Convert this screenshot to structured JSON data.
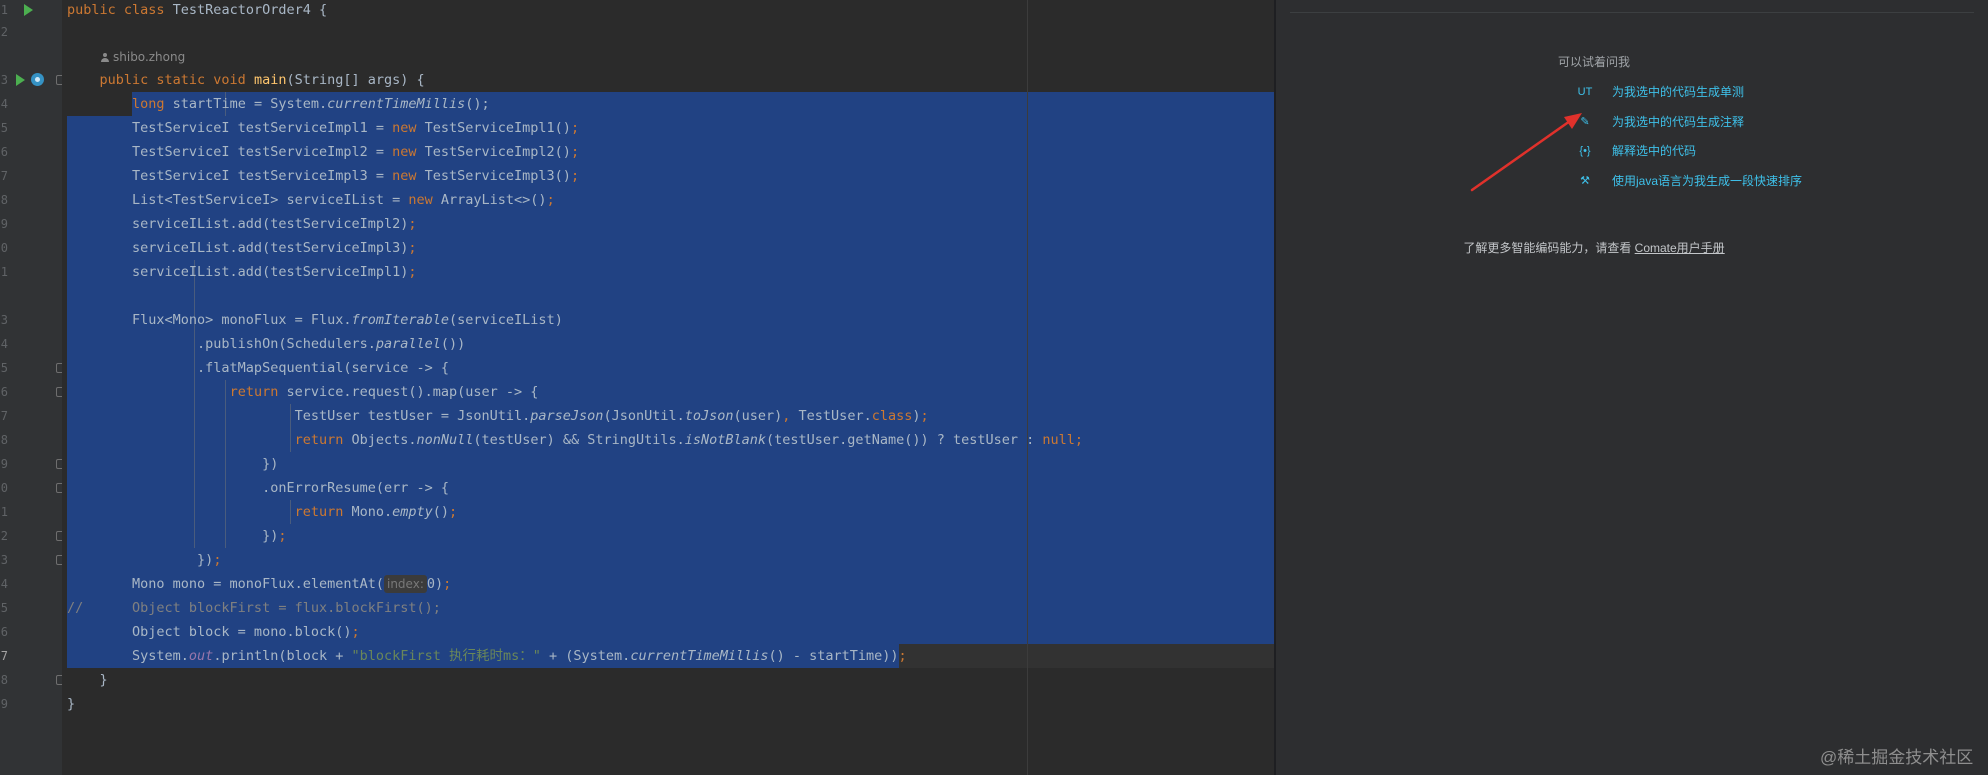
{
  "editor": {
    "author": "shibo.zhong",
    "param_hint": "index:",
    "line_numbers": [
      "1",
      "2",
      "",
      "3",
      "4",
      "5",
      "6",
      "7",
      "8",
      "9",
      "0",
      "1",
      "",
      "3",
      "4",
      "5",
      "6",
      "7",
      "8",
      "9",
      "0",
      "1",
      "2",
      "3",
      "4",
      "5",
      "6",
      "7",
      "8",
      "9",
      ""
    ],
    "code": {
      "l1a": "public class ",
      "l1b": "TestReactorOrder4 {",
      "l3a": "    public static void ",
      "l3b": "main",
      "l3c": "(String[] args) {",
      "l4a": "        long ",
      "l4b": "startTime = System.",
      "l4c": "currentTimeMillis",
      "l4d": "();",
      "l5a": "        TestServiceI testServiceImpl1 = ",
      "l5b": "new ",
      "l5c": "TestServiceImpl1()",
      "l5d": ";",
      "l6a": "        TestServiceI testServiceImpl2 = ",
      "l6b": "new ",
      "l6c": "TestServiceImpl2()",
      "l6d": ";",
      "l7a": "        TestServiceI testServiceImpl3 = ",
      "l7b": "new ",
      "l7c": "TestServiceImpl3()",
      "l7d": ";",
      "l8a": "        List<TestServiceI> serviceIList = ",
      "l8b": "new ",
      "l8c": "ArrayList<>()",
      "l8d": ";",
      "l9a": "        serviceIList.add(testServiceImpl2)",
      "l9b": ";",
      "l10a": "        serviceIList.add(testServiceImpl3)",
      "l10b": ";",
      "l11a": "        serviceIList.add(testServiceImpl1)",
      "l11b": ";",
      "l13a": "        Flux<Mono> monoFlux = Flux.",
      "l13b": "fromIterable",
      "l13c": "(serviceIList)",
      "l14a": "                .publishOn(Schedulers.",
      "l14b": "parallel",
      "l14c": "())",
      "l15a": "                .flatMapSequential(service -> {",
      "l16a": "                    ",
      "l16b": "return ",
      "l16c": "service.request().map(user -> {",
      "l17a": "                            TestUser testUser = JsonUtil.",
      "l17b": "parseJson",
      "l17c": "(JsonUtil.",
      "l17d": "toJson",
      "l17e": "(user)",
      "l17f": ", ",
      "l17g": "TestUser.",
      "l17h": "class",
      "l17i": ")",
      "l17j": ";",
      "l18a": "                            ",
      "l18b": "return ",
      "l18c": "Objects.",
      "l18d": "nonNull",
      "l18e": "(testUser) && StringUtils.",
      "l18f": "isNotBlank",
      "l18g": "(testUser.getName()) ? testUser : ",
      "l18h": "null",
      "l18i": ";",
      "l19a": "                        })",
      "l20a": "                        .onErrorResume(err -> {",
      "l21a": "                            ",
      "l21b": "return ",
      "l21c": "Mono.",
      "l21d": "empty",
      "l21e": "()",
      "l21f": ";",
      "l22a": "                        })",
      "l22b": ";",
      "l23a": "                })",
      "l23b": ";",
      "l24a": "        Mono mono = monoFlux.elementAt(",
      "l24c": "0)",
      "l24d": ";",
      "l25a": "//      Object blockFirst = flux.blockFirst();",
      "l26a": "        Object block = mono.block()",
      "l26b": ";",
      "l27a": "        System.",
      "l27b": "out",
      "l27c": ".println(block + ",
      "l27d": "\"blockFirst 执行耗时ms：\"",
      "l27e": " + (System.",
      "l27f": "currentTimeMillis",
      "l27g": "() - startTime))",
      "l27h": ";",
      "l28a": "    }",
      "l29a": "}"
    }
  },
  "assistant": {
    "title": "可以试着问我",
    "suggestions": [
      {
        "icon": "unit-test-icon",
        "glyph": "UT",
        "label": "为我选中的代码生成单测"
      },
      {
        "icon": "comment-doc-icon",
        "glyph": "✎",
        "label": "为我选中的代码生成注释"
      },
      {
        "icon": "explain-code-icon",
        "glyph": "{•}",
        "label": "解释选中的代码"
      },
      {
        "icon": "tools-icon",
        "glyph": "⚒",
        "label": "使用java语言为我生成一段快速排序"
      }
    ],
    "more_text": "了解更多智能编码能力，请查看 ",
    "manual_link": "Comate用户手册"
  },
  "watermark": "@稀土掘金技术社区",
  "colors": {
    "selection": "#214283",
    "keyword": "#cc7832",
    "method": "#ffc66d",
    "string": "#6a8759",
    "link": "#3ec1ea",
    "annotation_arrow": "#e0312b",
    "scroll_marker": "#be9117"
  }
}
